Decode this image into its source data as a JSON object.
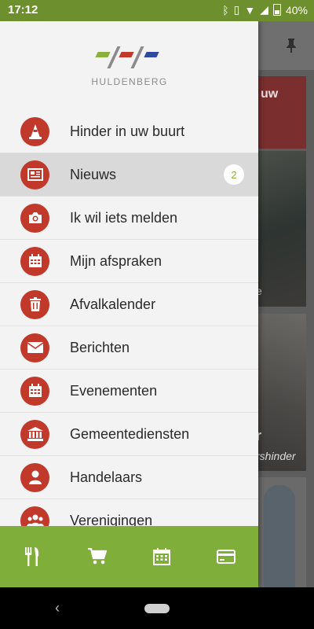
{
  "status_bar": {
    "time": "17:12",
    "battery": "40%",
    "icons": [
      "bluetooth-icon",
      "vibrate-icon",
      "wifi-icon",
      "signal-icon",
      "battery-icon"
    ]
  },
  "app": {
    "logo_text": "HULDENBERG",
    "accent_color": "#c0392b",
    "green_color": "#7fae3a"
  },
  "menu": {
    "items": [
      {
        "label": "Hinder in uw buurt",
        "icon": "traffic-cone-icon"
      },
      {
        "label": "Nieuws",
        "icon": "newspaper-icon",
        "badge": "2"
      },
      {
        "label": "Ik wil iets melden",
        "icon": "camera-icon"
      },
      {
        "label": "Mijn afspraken",
        "icon": "calendar-icon"
      },
      {
        "label": "Afvalkalender",
        "icon": "trash-icon"
      },
      {
        "label": "Berichten",
        "icon": "envelope-icon"
      },
      {
        "label": "Evenementen",
        "icon": "calendar-icon"
      },
      {
        "label": "Gemeentediensten",
        "icon": "building-icon"
      },
      {
        "label": "Handelaars",
        "icon": "user-icon"
      },
      {
        "label": "Verenigingen",
        "icon": "group-icon"
      }
    ]
  },
  "bottom_bar": {
    "items": [
      "fork-knife-icon",
      "cart-icon",
      "calendar-icon",
      "credit-card-icon"
    ]
  },
  "background": {
    "red_card_text": "uw",
    "card1_text": "e",
    "card2_title": "r",
    "card2_subtitle": "rshinder"
  }
}
